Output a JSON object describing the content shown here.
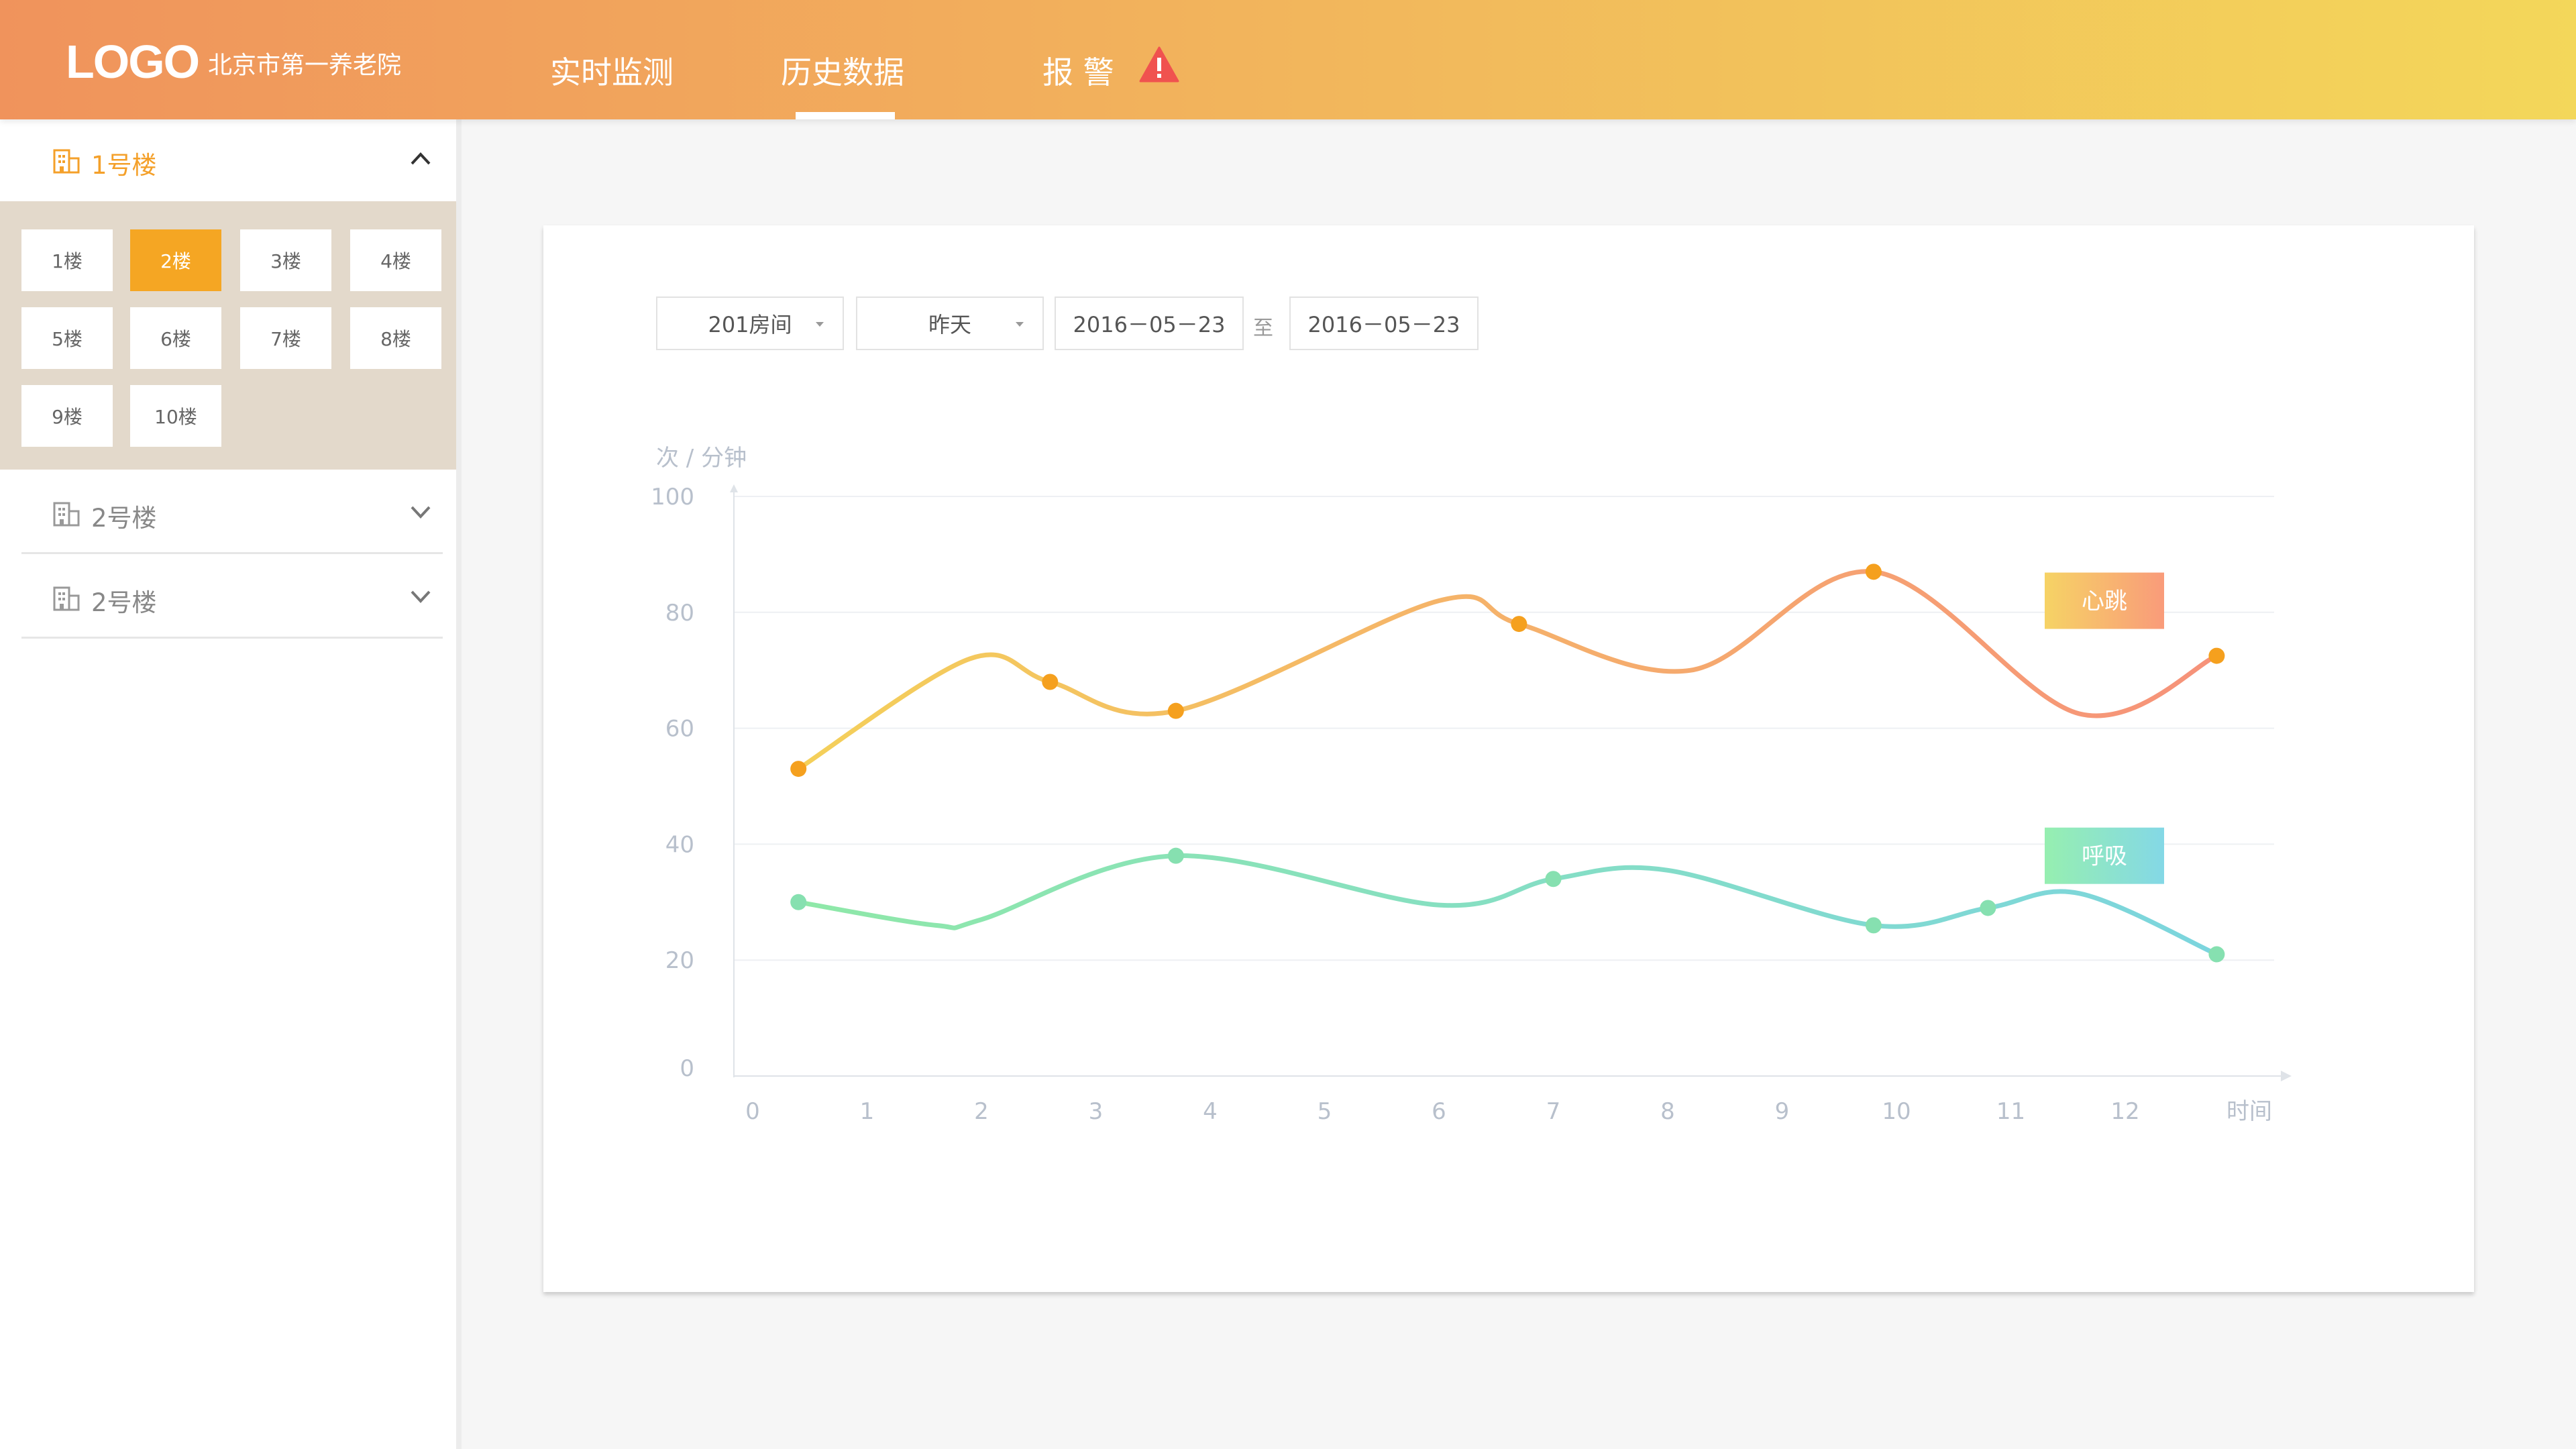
{
  "header": {
    "logo": "LOGO",
    "org_name": "北京市第一养老院",
    "nav": [
      {
        "label": "实时监测",
        "active": false
      },
      {
        "label": "历史数据",
        "active": true
      },
      {
        "label": "报 警",
        "active": false
      }
    ],
    "alarm_icon": "warning-icon"
  },
  "sidebar": {
    "buildings": [
      {
        "label": "1号楼",
        "expanded": true
      },
      {
        "label": "2号楼",
        "expanded": false
      },
      {
        "label": "2号楼",
        "expanded": false
      }
    ],
    "floors": [
      "1楼",
      "2楼",
      "3楼",
      "4楼",
      "5楼",
      "6楼",
      "7楼",
      "8楼",
      "9楼",
      "10楼"
    ],
    "active_floor": "2楼"
  },
  "filters": {
    "room": "201房间",
    "period": "昨天",
    "start_date": "2016－05－23",
    "separator": "至",
    "end_date": "2016－05－23"
  },
  "colors": {
    "accent": "#f5a623",
    "heart_start": "#f4d05a",
    "heart_end": "#f6927a",
    "breath_start": "#8fe8a8",
    "breath_end": "#7cd5de"
  },
  "chart_data": {
    "type": "line",
    "ylabel": "次 / 分钟",
    "xlabel": "时间",
    "ylim": [
      0,
      100
    ],
    "yticks": [
      0,
      20,
      40,
      60,
      80,
      100
    ],
    "xlim": [
      0,
      13
    ],
    "xticks": [
      0,
      1,
      2,
      3,
      4,
      5,
      6,
      7,
      8,
      9,
      10,
      11,
      12
    ],
    "grid": true,
    "series": [
      {
        "name": "心跳",
        "points": [
          [
            0.4,
            53
          ],
          [
            2.6,
            68
          ],
          [
            3.7,
            63
          ],
          [
            6.7,
            78
          ],
          [
            9.8,
            87
          ],
          [
            12.8,
            72.5
          ]
        ],
        "curve": [
          [
            0.4,
            53
          ],
          [
            1.9,
            72
          ],
          [
            2.6,
            68
          ],
          [
            3.7,
            63
          ],
          [
            6.0,
            82
          ],
          [
            6.7,
            78
          ],
          [
            8.2,
            70
          ],
          [
            9.8,
            87
          ],
          [
            11.6,
            62.5
          ],
          [
            12.8,
            72.5
          ]
        ]
      },
      {
        "name": "呼吸",
        "points": [
          [
            0.4,
            30
          ],
          [
            3.7,
            38
          ],
          [
            7.0,
            34
          ],
          [
            9.8,
            26
          ],
          [
            10.8,
            29
          ],
          [
            12.8,
            21
          ]
        ],
        "curve": [
          [
            0.4,
            30
          ],
          [
            1.6,
            26
          ],
          [
            2.0,
            27
          ],
          [
            3.7,
            38
          ],
          [
            6.0,
            29.5
          ],
          [
            7.0,
            34
          ],
          [
            8.0,
            35.5
          ],
          [
            9.8,
            26
          ],
          [
            10.8,
            29
          ],
          [
            11.6,
            31.5
          ],
          [
            12.8,
            21
          ]
        ]
      }
    ]
  }
}
